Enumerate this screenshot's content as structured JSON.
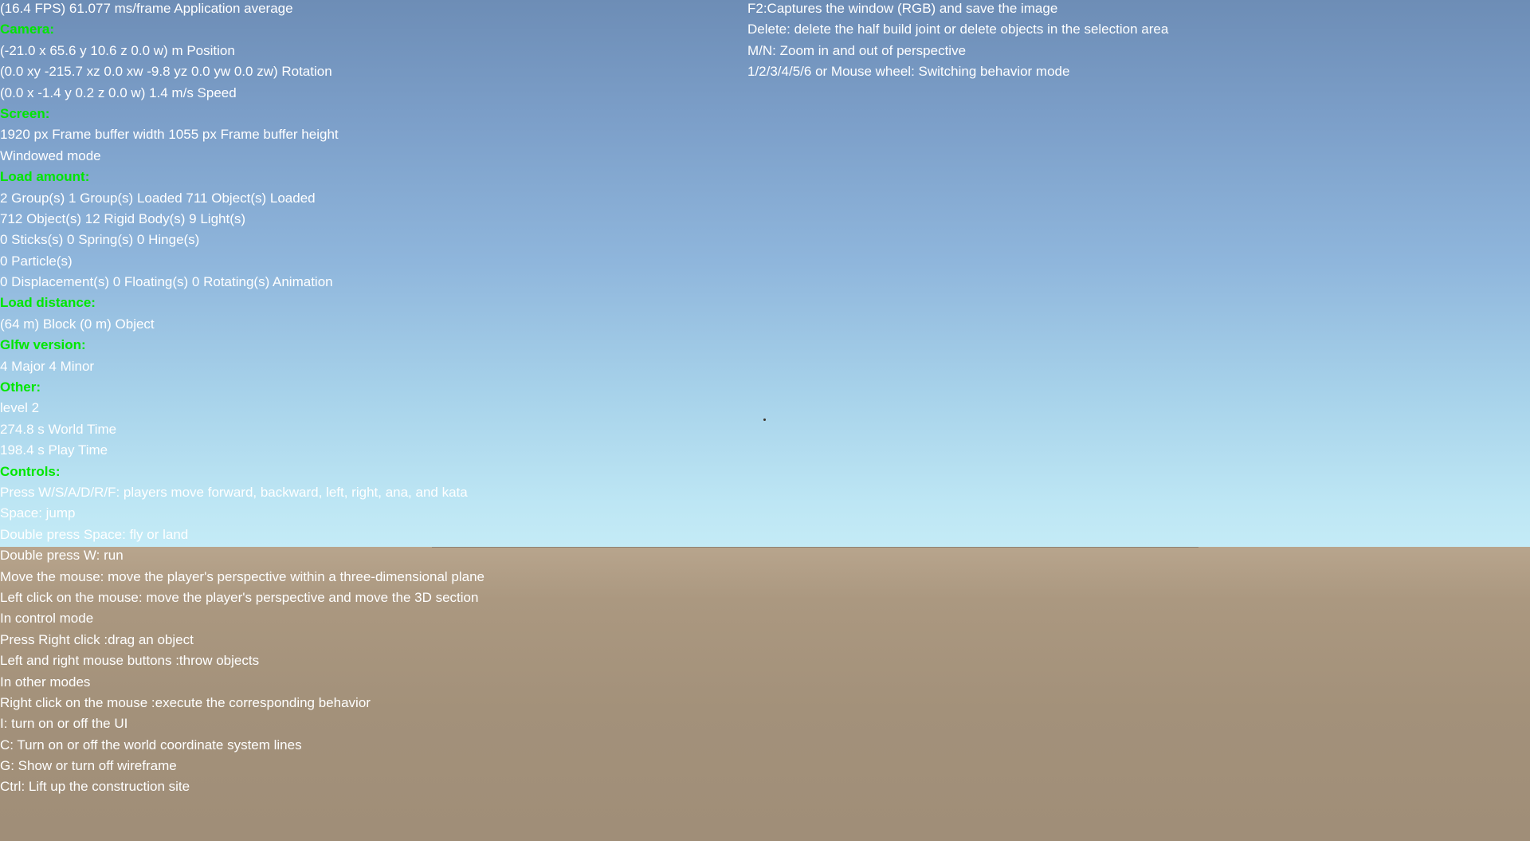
{
  "scene": {
    "sky_color_top": "#6d8db6",
    "sky_color_horizon": "#c4ebf6",
    "ground_color": "#a3917a",
    "section_header_color": "#00e600",
    "text_color": "#ffffff"
  },
  "hud_left": [
    {
      "kind": "text",
      "text": "(16.4 FPS) 61.077 ms/frame Application average"
    },
    {
      "kind": "section",
      "text": "Camera:"
    },
    {
      "kind": "text",
      "text": "(-21.0 x  65.6 y  10.6 z  0.0 w) m Position"
    },
    {
      "kind": "text",
      "text": "(0.0 xy -215.7 xz 0.0 xw -9.8 yz 0.0 yw 0.0 zw)  Rotation"
    },
    {
      "kind": "text",
      "text": "(0.0 x -1.4 y 0.2 z 0.0 w) 1.4 m/s Speed"
    },
    {
      "kind": "section",
      "text": "Screen:"
    },
    {
      "kind": "text",
      "text": "1920 px Frame buffer width 1055 px Frame buffer height"
    },
    {
      "kind": "text",
      "text": "Windowed mode"
    },
    {
      "kind": "section",
      "text": "Load amount:"
    },
    {
      "kind": "text",
      "text": "2 Group(s) 1 Group(s) Loaded 711 Object(s) Loaded"
    },
    {
      "kind": "text",
      "text": "712 Object(s) 12 Rigid Body(s) 9 Light(s)"
    },
    {
      "kind": "text",
      "text": "0 Sticks(s) 0 Spring(s) 0 Hinge(s)"
    },
    {
      "kind": "text",
      "text": "0 Particle(s)"
    },
    {
      "kind": "text",
      "text": "0 Displacement(s) 0 Floating(s) 0 Rotating(s) Animation"
    },
    {
      "kind": "section",
      "text": "Load distance:"
    },
    {
      "kind": "text",
      "text": "(64 m) Block (0 m) Object"
    },
    {
      "kind": "section",
      "text": "Glfw version:"
    },
    {
      "kind": "text",
      "text": "4 Major 4 Minor"
    },
    {
      "kind": "section",
      "text": "Other:"
    },
    {
      "kind": "text",
      "text": "level 2"
    },
    {
      "kind": "text",
      "text": "274.8 s World Time"
    },
    {
      "kind": "text",
      "text": "198.4 s Play Time"
    },
    {
      "kind": "section",
      "text": "Controls:"
    },
    {
      "kind": "text",
      "text": "Press W/S/A/D/R/F: players move forward, backward, left, right, ana, and kata"
    },
    {
      "kind": "text",
      "text": "Space: jump"
    },
    {
      "kind": "text",
      "text": "Double press Space: fly or land"
    },
    {
      "kind": "text",
      "text": "Double press W: run"
    },
    {
      "kind": "text",
      "text": "Move the mouse: move the player's perspective within a three-dimensional plane"
    },
    {
      "kind": "text",
      "text": "Left click on the mouse: move the player's perspective and move the 3D section"
    },
    {
      "kind": "text",
      "text": "In control mode"
    },
    {
      "kind": "text",
      "text": "Press Right click :drag an object"
    },
    {
      "kind": "text",
      "text": "Left and right mouse buttons :throw objects"
    },
    {
      "kind": "text",
      "text": "In other modes"
    },
    {
      "kind": "text",
      "text": "Right click on the mouse :execute the corresponding behavior"
    },
    {
      "kind": "text",
      "text": "I: turn on or off the UI"
    },
    {
      "kind": "text",
      "text": "C: Turn on or off the world coordinate system lines"
    },
    {
      "kind": "text",
      "text": "G: Show or turn off wireframe"
    },
    {
      "kind": "text",
      "text": "Ctrl: Lift up the construction site"
    }
  ],
  "hud_right": [
    {
      "kind": "text",
      "text": "F2:Captures the window (RGB) and save the image"
    },
    {
      "kind": "text",
      "text": "Delete: delete the half build joint or delete objects in the selection area"
    },
    {
      "kind": "text",
      "text": "M/N: Zoom in and out of perspective"
    },
    {
      "kind": "text",
      "text": "1/2/3/4/5/6 or Mouse wheel: Switching behavior mode"
    }
  ]
}
